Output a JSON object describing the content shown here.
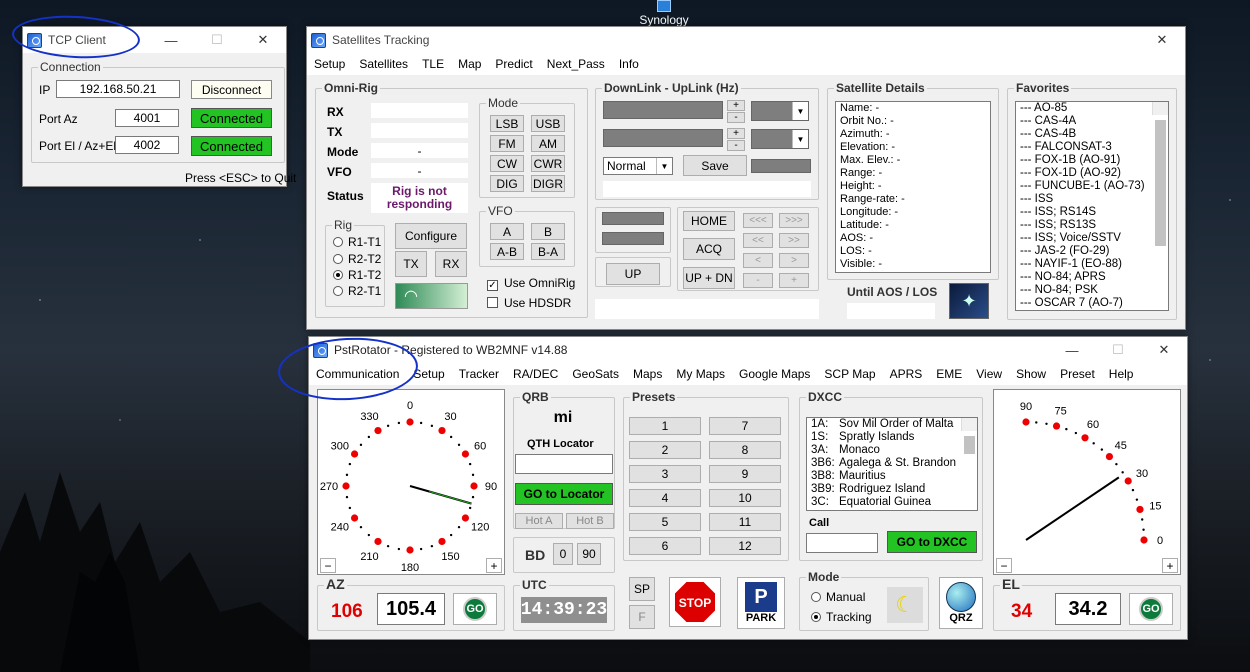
{
  "desktop": {
    "icon_label": "Synology"
  },
  "tcp": {
    "title": "TCP Client",
    "connection_label": "Connection",
    "ip_label": "IP",
    "ip_value": "192.168.50.21",
    "disconnect": "Disconnect",
    "port_az_label": "Port Az",
    "port_az": "4001",
    "port_el_label": "Port El / Az+El",
    "port_el": "4002",
    "status1": "Connected",
    "status2": "Connected",
    "hint": "Press <ESC> to Quit"
  },
  "sat": {
    "title": "Satellites Tracking",
    "menu": [
      "Setup",
      "Satellites",
      "TLE",
      "Map",
      "Predict",
      "Next_Pass",
      "Info"
    ],
    "omni_label": "Omni-Rig",
    "rx": "RX",
    "tx": "TX",
    "mode": "Mode",
    "vfo": "VFO",
    "status": "Status",
    "mode_val": "-",
    "vfo_val": "-",
    "status_msg": "Rig is not responding",
    "mode_group": "Mode",
    "modes": [
      "LSB",
      "USB",
      "FM",
      "AM",
      "CW",
      "CWR",
      "DIG",
      "DIGR"
    ],
    "vfo_group": "VFO",
    "vfo_btns": [
      "A",
      "B",
      "A-B",
      "B-A"
    ],
    "use_omnirig": "Use OmniRig",
    "use_hdsdr": "Use HDSDR",
    "rig_group": "Rig",
    "rigs": [
      "R1-T1",
      "R2-T2",
      "R1-T2",
      "R2-T1"
    ],
    "configure": "Configure",
    "tx_btn": "TX",
    "rx_btn": "RX",
    "downlink_label": "DownLink - UpLink (Hz)",
    "plus": "+",
    "minus": "-",
    "normal": "Normal",
    "save": "Save",
    "up": "UP",
    "home": "HOME",
    "acq": "ACQ",
    "updn": "UP + DN",
    "arrows": [
      "<<<",
      ">>>",
      "<<",
      ">>",
      "<",
      ">",
      "-",
      "+"
    ],
    "details_label": "Satellite Details",
    "details": [
      "Name: -",
      "Orbit No.: -",
      "Azimuth: -",
      "Elevation: -",
      "Max. Elev.: -",
      "Range: -",
      "Height: -",
      "Range-rate: -",
      "Longitude: -",
      "Latitude: -",
      "AOS: -",
      "LOS: -",
      "Visible: -"
    ],
    "until": "Until AOS / LOS",
    "fav_label": "Favorites",
    "favorites": [
      "--- AO-85",
      "--- CAS-4A",
      "--- CAS-4B",
      "--- FALCONSAT-3",
      "--- FOX-1B (AO-91)",
      "--- FOX-1D (AO-92)",
      "--- FUNCUBE-1 (AO-73)",
      "--- ISS",
      "--- ISS; RS14S",
      "--- ISS; RS13S",
      "--- ISS; Voice/SSTV",
      "--- JAS-2 (FO-29)",
      "--- NAYIF-1 (EO-88)",
      "--- NO-84; APRS",
      "--- NO-84; PSK",
      "--- OSCAR 7 (AO-7)"
    ]
  },
  "pst": {
    "title": "PstRotator - Registered to WB2MNF   v14.88",
    "menu": [
      "Communication",
      "Setup",
      "Tracker",
      "RA/DEC",
      "GeoSats",
      "Maps",
      "My Maps",
      "Google Maps",
      "SCP Map",
      "APRS",
      "EME",
      "View",
      "Show",
      "Preset",
      "Help"
    ],
    "az_ticks": [
      "0",
      "30",
      "60",
      "90",
      "120",
      "150",
      "180",
      "210",
      "240",
      "270",
      "300",
      "330"
    ],
    "qrb_label": "QRB",
    "qrb_unit": "mi",
    "qth_label": "QTH Locator",
    "go_locator": "GO to Locator",
    "hot_a": "Hot A",
    "hot_b": "Hot B",
    "bd_label": "BD",
    "bd0": "0",
    "bd90": "90",
    "presets_label": "Presets",
    "presets": [
      "1",
      "7",
      "2",
      "8",
      "3",
      "9",
      "4",
      "10",
      "5",
      "11",
      "6",
      "12"
    ],
    "dxcc_label": "DXCC",
    "dxcc": [
      [
        "1A:",
        "Sov Mil Order of Malta"
      ],
      [
        "1S:",
        "Spratly Islands"
      ],
      [
        "3A:",
        "Monaco"
      ],
      [
        "3B6:",
        "Agalega & St. Brandon"
      ],
      [
        "3B8:",
        "Mauritius"
      ],
      [
        "3B9:",
        "Rodriguez Island"
      ],
      [
        "3C:",
        "Equatorial Guinea"
      ]
    ],
    "call_label": "Call",
    "go_dxcc": "GO to DXCC",
    "el_ticks": [
      "0",
      "15",
      "30",
      "45",
      "60",
      "75",
      "90"
    ],
    "az_label": "AZ",
    "az_red": "106",
    "az_val": "105.4",
    "go": "GO",
    "utc_label": "UTC",
    "utc": "14:39:23",
    "sp": "SP",
    "f": "F",
    "stop": "STOP",
    "park": "PARK",
    "mode_label": "Mode",
    "manual": "Manual",
    "tracking": "Tracking",
    "qrz": "QRZ",
    "el_label": "EL",
    "el_red": "34",
    "el_val": "34.2",
    "az_heading": 106,
    "el_angle": 34
  }
}
